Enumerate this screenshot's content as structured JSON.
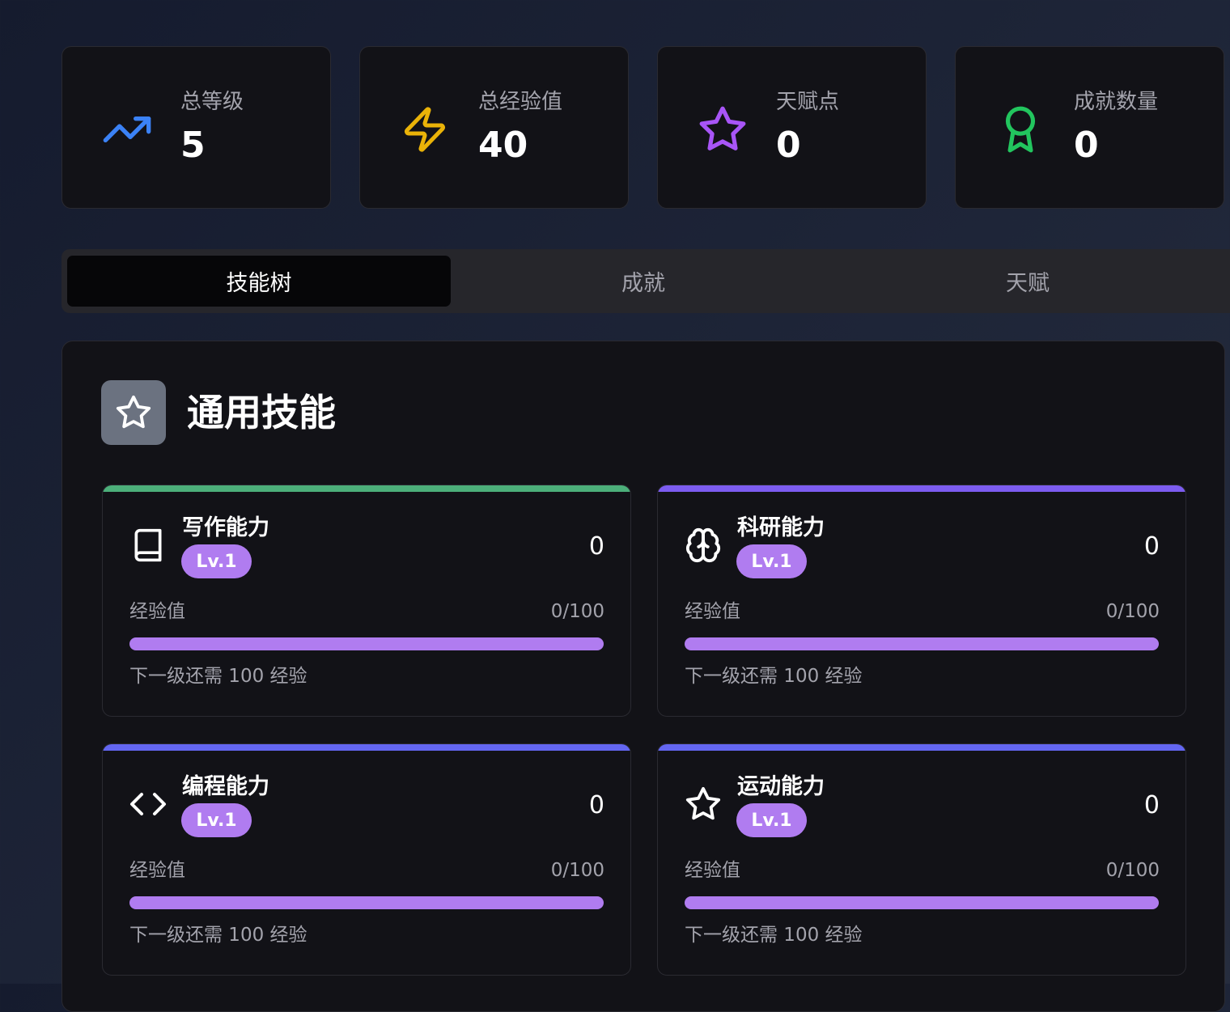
{
  "stats": [
    {
      "label": "总等级",
      "value": "5",
      "icon": "trending-up-icon",
      "color": "#3b82f6"
    },
    {
      "label": "总经验值",
      "value": "40",
      "icon": "lightning-icon",
      "color": "#eab308"
    },
    {
      "label": "天赋点",
      "value": "0",
      "icon": "star-icon",
      "color": "#a855f7"
    },
    {
      "label": "成就数量",
      "value": "0",
      "icon": "award-icon",
      "color": "#22c55e"
    }
  ],
  "tabs": [
    {
      "label": "技能树",
      "active": true
    },
    {
      "label": "成就",
      "active": false
    },
    {
      "label": "天赋",
      "active": false
    }
  ],
  "section": {
    "title": "通用技能",
    "icon": "star-icon"
  },
  "skills": [
    {
      "name": "写作能力",
      "level": "Lv.1",
      "points": "0",
      "xp_label": "经验值",
      "xp_value": "0/100",
      "xp_progress": 0,
      "next_level": "下一级还需 100 经验",
      "icon": "book-icon",
      "accent": "#4caf7a"
    },
    {
      "name": "科研能力",
      "level": "Lv.1",
      "points": "0",
      "xp_label": "经验值",
      "xp_value": "0/100",
      "xp_progress": 0,
      "next_level": "下一级还需 100 经验",
      "icon": "brain-icon",
      "accent": "#7c5cf0"
    },
    {
      "name": "编程能力",
      "level": "Lv.1",
      "points": "0",
      "xp_label": "经验值",
      "xp_value": "0/100",
      "xp_progress": 0,
      "next_level": "下一级还需 100 经验",
      "icon": "code-icon",
      "accent": "#6366f1"
    },
    {
      "name": "运动能力",
      "level": "Lv.1",
      "points": "0",
      "xp_label": "经验值",
      "xp_value": "0/100",
      "xp_progress": 0,
      "next_level": "下一级还需 100 经验",
      "icon": "star-icon",
      "accent": "#6366f1"
    }
  ]
}
